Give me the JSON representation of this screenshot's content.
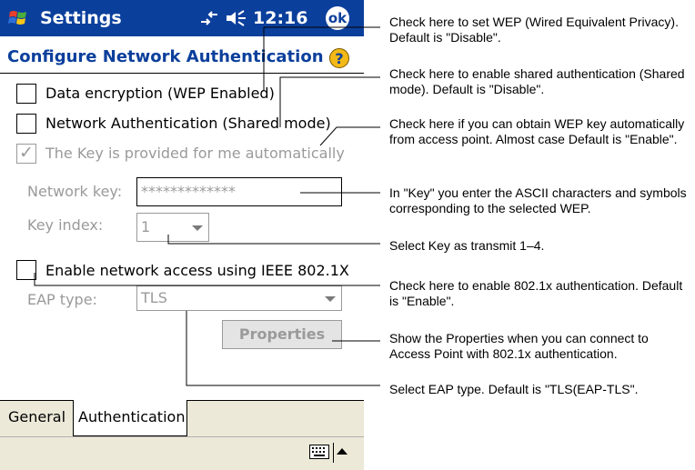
{
  "titlebar": {
    "app_name": "Settings",
    "time": "12:16",
    "ok_label": "ok"
  },
  "header": {
    "title": "Configure Network Authentication",
    "help_label": "?"
  },
  "options": {
    "data_encryption": {
      "label": "Data encryption (WEP Enabled)",
      "checked": false
    },
    "network_auth": {
      "label": "Network Authentication (Shared mode)",
      "checked": false
    },
    "key_auto": {
      "label": "The Key is provided for me automatically",
      "checked": true,
      "enabled": false
    }
  },
  "fields": {
    "network_key": {
      "label": "Network key:",
      "value": "*************"
    },
    "key_index": {
      "label": "Key index:",
      "value": "1"
    }
  },
  "ieee": {
    "label": "Enable network access using IEEE 802.1X",
    "checked": false
  },
  "eap": {
    "label": "EAP type:",
    "value": "TLS"
  },
  "properties_label": "Properties",
  "tabs": [
    {
      "label": "General"
    },
    {
      "label": "Authentication",
      "active": true
    }
  ],
  "annotations": {
    "wep": "Check here to set WEP (Wired Equivalent Privacy). Default is \"Disable\".",
    "shared": "Check here to enable shared authentication (Shared mode). Default is \"Disable\".",
    "auto_key": "Check here if you can obtain WEP key automatically from access point. Almost case Default is \"Enable\".",
    "key": "In \"Key\" you enter the ASCII characters and symbols corresponding to the selected WEP.",
    "index": "Select Key as transmit 1–4.",
    "dot1x": "Check here to enable 802.1x authentication. Default is \"Enable\".",
    "properties": "Show the Properties when you can connect to Access Point with 802.1x authentication.",
    "eap_type": "Select EAP type. Default is \"TLS(EAP-TLS\"."
  }
}
